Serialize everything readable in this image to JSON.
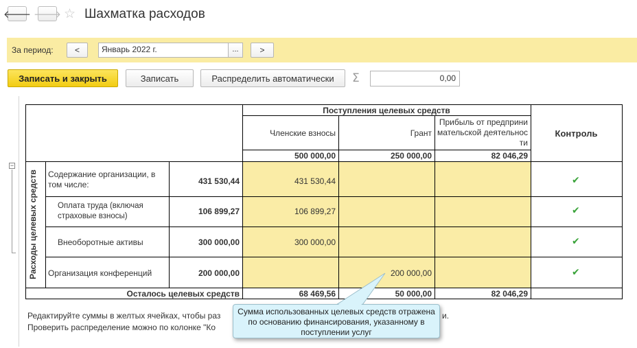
{
  "header": {
    "title": "Шахматка расходов"
  },
  "period": {
    "label": "За период:",
    "prev": "<",
    "value": "Январь 2022 г.",
    "choose": "...",
    "next": ">"
  },
  "toolbar": {
    "save_close": "Записать и закрыть",
    "save": "Записать",
    "distribute": "Распределить автоматически",
    "sigma": "Σ",
    "total": "0,00"
  },
  "grid": {
    "group_header": "Поступления целевых средств",
    "columns": [
      "Членские взносы",
      "Грант",
      "Прибыль от предпринимательской деятельности"
    ],
    "col_totals": [
      "500 000,00",
      "250 000,00",
      "82 046,29"
    ],
    "control_header": "Контроль",
    "row_group_label": "Расходы целевых средств",
    "rows": [
      {
        "name": "Содержание организации, в том числе:",
        "total": "431 530,44",
        "v1": "431 530,44",
        "v2": "",
        "v3": "",
        "control": "✔"
      },
      {
        "name": "Оплата труда (включая страховые взносы)",
        "total": "106 899,27",
        "v1": "106 899,27",
        "v2": "",
        "v3": "",
        "control": "✔"
      },
      {
        "name": "Внеоборотные активы",
        "total": "300 000,00",
        "v1": "300 000,00",
        "v2": "",
        "v3": "",
        "control": "✔"
      },
      {
        "name": "Организация конференций",
        "total": "200 000,00",
        "v1": "",
        "v2": "200 000,00",
        "v3": "",
        "control": "✔"
      }
    ],
    "remaining_label": "Осталось целевых средств",
    "remaining": [
      "68 469,56",
      "50 000,00",
      "82 046,29"
    ]
  },
  "notes": {
    "line1": "Редактируйте суммы в желтых ячейках, чтобы раз",
    "line1_end": "и.",
    "line2": "Проверить распределение можно по колонке \"Ко"
  },
  "callout": {
    "text": "Сумма использованных целевых средств отражена по основанию финансирования, указанному в поступлении услуг"
  },
  "colors": {
    "yellow_cells": "#faeca6",
    "period_bar": "#faeca3",
    "primary_button": "#f5d320",
    "check": "#3aa33a",
    "callout_bg": "#d9f3fb"
  }
}
